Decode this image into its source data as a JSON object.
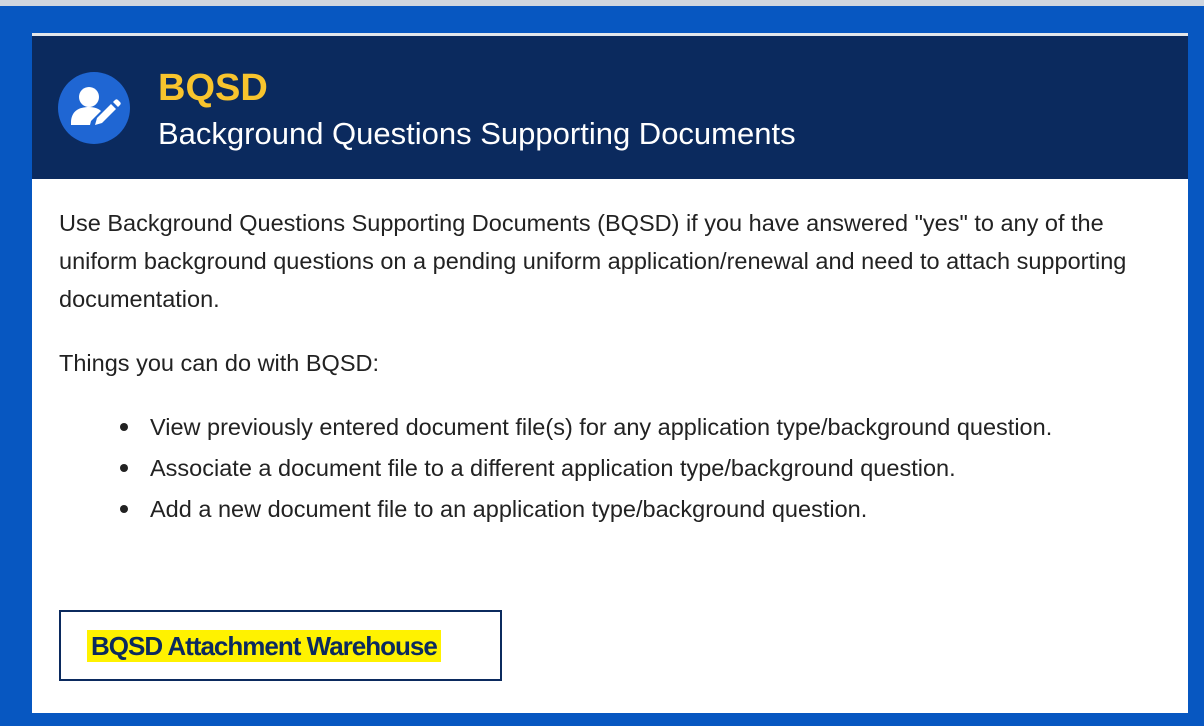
{
  "header": {
    "icon": "user-edit-icon",
    "abbreviation": "BQSD",
    "title": "Background Questions Supporting Documents"
  },
  "body": {
    "intro": "Use Background Questions Supporting Documents (BQSD) if you have answered \"yes\" to any of the uniform background questions on a pending uniform application/renewal and need to attach supporting documentation.",
    "things_heading": "Things you can do with BQSD:",
    "features": [
      "View previously entered document file(s) for any application type/background question.",
      "Associate a document file to a different application type/background question.",
      "Add a new document file to an application type/background question."
    ]
  },
  "action": {
    "button_label": "BQSD Attachment Warehouse"
  },
  "colors": {
    "frame_blue": "#0757c1",
    "header_navy": "#0b2a5e",
    "accent_yellow": "#f8c42d",
    "highlight": "#fff200"
  }
}
